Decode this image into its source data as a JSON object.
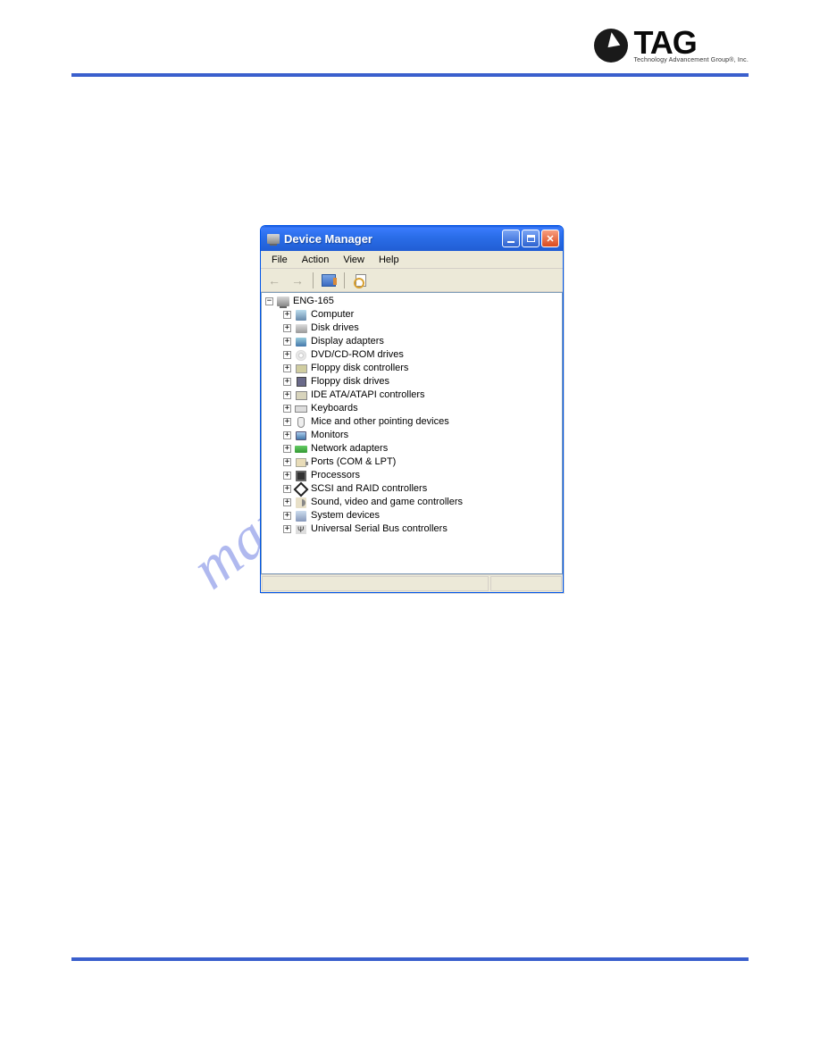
{
  "page": {
    "logo_text": "TAG",
    "logo_sub": "Technology Advancement Group®, Inc."
  },
  "watermark": "manualshive.com",
  "window": {
    "title": "Device Manager",
    "menu": [
      "File",
      "Action",
      "View",
      "Help"
    ],
    "root": {
      "label": "ENG-165",
      "expanded": true
    },
    "nodes": [
      {
        "label": "Computer",
        "icon": "ic-pc"
      },
      {
        "label": "Disk drives",
        "icon": "ic-disk"
      },
      {
        "label": "Display adapters",
        "icon": "ic-display"
      },
      {
        "label": "DVD/CD-ROM drives",
        "icon": "ic-dvd"
      },
      {
        "label": "Floppy disk controllers",
        "icon": "ic-floppy-ctrl"
      },
      {
        "label": "Floppy disk drives",
        "icon": "ic-floppy"
      },
      {
        "label": "IDE ATA/ATAPI controllers",
        "icon": "ic-ide"
      },
      {
        "label": "Keyboards",
        "icon": "ic-keyboard"
      },
      {
        "label": "Mice and other pointing devices",
        "icon": "ic-mouse"
      },
      {
        "label": "Monitors",
        "icon": "ic-monitor"
      },
      {
        "label": "Network adapters",
        "icon": "ic-network"
      },
      {
        "label": "Ports (COM & LPT)",
        "icon": "ic-ports"
      },
      {
        "label": "Processors",
        "icon": "ic-processor"
      },
      {
        "label": "SCSI and RAID controllers",
        "icon": "ic-scsi"
      },
      {
        "label": "Sound, video and game controllers",
        "icon": "ic-sound"
      },
      {
        "label": "System devices",
        "icon": "ic-system"
      },
      {
        "label": "Universal Serial Bus controllers",
        "icon": "ic-usb"
      }
    ]
  }
}
